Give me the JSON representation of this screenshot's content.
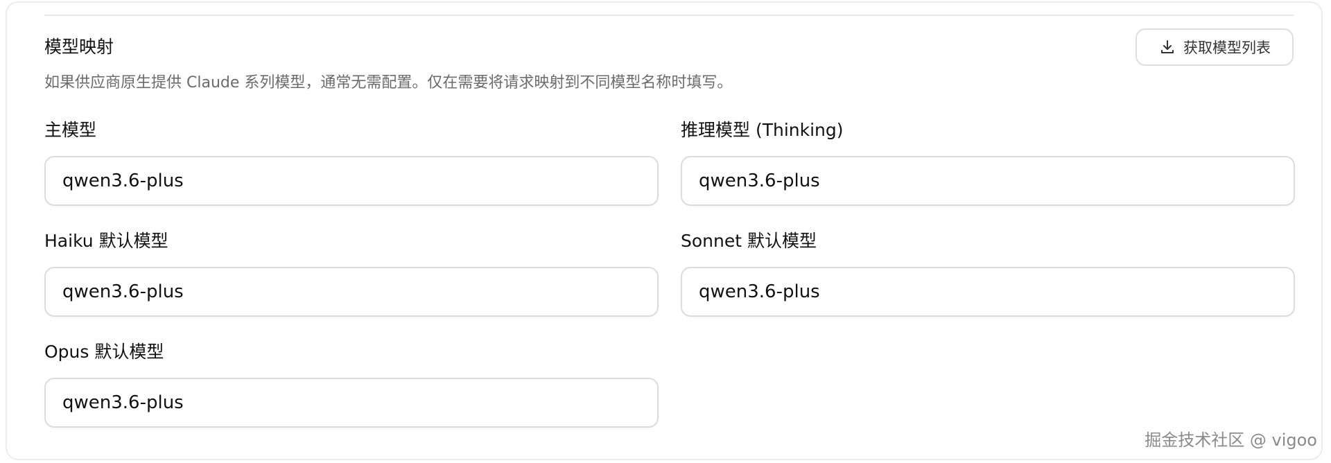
{
  "section": {
    "title": "模型映射",
    "description": "如果供应商原生提供 Claude 系列模型，通常无需配置。仅在需要将请求映射到不同模型名称时填写。",
    "fetch_button_label": "获取模型列表",
    "fetch_button_icon": "download-icon"
  },
  "fields": {
    "main_model": {
      "label": "主模型",
      "value": "qwen3.6-plus"
    },
    "thinking_model": {
      "label": "推理模型 (Thinking)",
      "value": "qwen3.6-plus"
    },
    "haiku_model": {
      "label": "Haiku 默认模型",
      "value": "qwen3.6-plus"
    },
    "sonnet_model": {
      "label": "Sonnet 默认模型",
      "value": "qwen3.6-plus"
    },
    "opus_model": {
      "label": "Opus 默认模型",
      "value": "qwen3.6-plus"
    }
  },
  "watermark": "掘金技术社区 @ vigoo",
  "colors": {
    "border": "#dcdcdc",
    "muted_text": "#6b6b6b",
    "text": "#111111"
  }
}
